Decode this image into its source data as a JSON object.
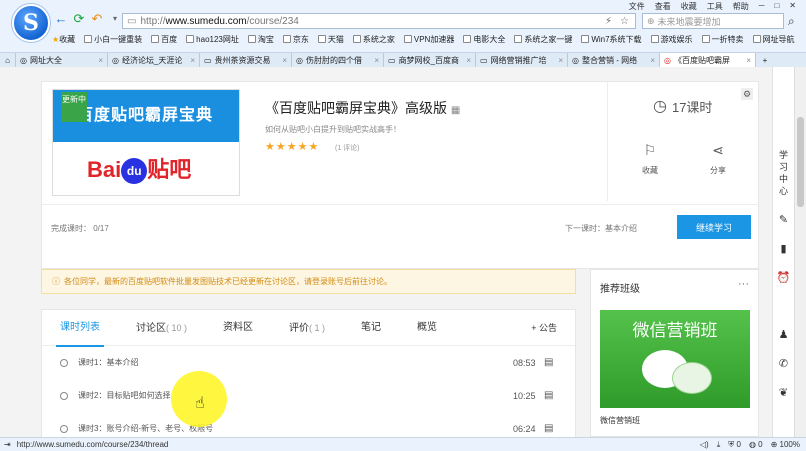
{
  "browser": {
    "top_menu": [
      "文件",
      "查看",
      "收藏",
      "工具",
      "帮助"
    ],
    "url_prefix": "http://",
    "url_host": "www.sumedu.com",
    "url_path": "/course/234",
    "search_placeholder": "未来地震要增加",
    "bookmarks": [
      "收藏",
      "小白一键重装",
      "百度",
      "hao123网址",
      "淘宝",
      "京东",
      "天猫",
      "系统之家",
      "VPN加速器",
      "电影大全",
      "系统之家一键",
      "Win7系统下载",
      "游戏娱乐",
      "一折特卖",
      "网址导航"
    ],
    "tabs": [
      {
        "label": "网址大全",
        "active": false
      },
      {
        "label": "经济论坛_天涯论",
        "active": false
      },
      {
        "label": "贵州茶资源交易",
        "active": false
      },
      {
        "label": "伤肘肘的四个借",
        "active": false
      },
      {
        "label": "商梦网校_百度商",
        "active": false
      },
      {
        "label": "网络营销推广培",
        "active": false
      },
      {
        "label": "整合营销 - 网络",
        "active": false
      },
      {
        "label": "《百度贴吧霸屏",
        "active": true
      }
    ],
    "status_url": "http://www.sumedu.com/course/234/thread",
    "status_right": [
      "0",
      "0",
      "100%"
    ]
  },
  "course": {
    "cover_badge": "更新中",
    "cover_title": "百度贴吧霸屏宝典",
    "cover_brand_a": "Bai",
    "cover_brand_du": "du",
    "cover_brand_b": "贴吧",
    "title": "《百度贴吧霸屏宝典》高级版",
    "subtitle": "如何从贴吧小白提升到贴吧实战高手！",
    "stars": "★★★★★",
    "rating_text": "(1 评论)",
    "hours": "17课时",
    "favorite_label": "收藏",
    "share_label": "分享",
    "progress_text": "完成课时： 0/17",
    "next_text": "下一课时：基本介绍",
    "continue_label": "继续学习"
  },
  "notice": "各位同学，最新的百度贴吧软件批量发图贴技术已经更新在讨论区，请登录账号后前往讨论。",
  "lesson_tabs": [
    {
      "label": "课时列表",
      "count": "",
      "active": true
    },
    {
      "label": "讨论区",
      "count": "( 10 )",
      "active": false
    },
    {
      "label": "资料区",
      "count": "",
      "active": false
    },
    {
      "label": "评价",
      "count": "( 1 )",
      "active": false
    },
    {
      "label": "笔记",
      "count": "",
      "active": false
    },
    {
      "label": "概览",
      "count": "",
      "active": false
    }
  ],
  "announce_label": "+ 公告",
  "lessons": [
    {
      "title": "课时1：基本介绍",
      "duration": "08:53"
    },
    {
      "title": "课时2：目标贴吧如何选择",
      "duration": "10:25"
    },
    {
      "title": "课时3：账号介绍-新号、老号、权限号",
      "duration": "06:24"
    }
  ],
  "recommend": {
    "title": "推荐班级",
    "more": "···",
    "image_text": "微信营销班",
    "name": "微信营销班"
  },
  "sidebar": {
    "learning_center": "学习中心"
  }
}
